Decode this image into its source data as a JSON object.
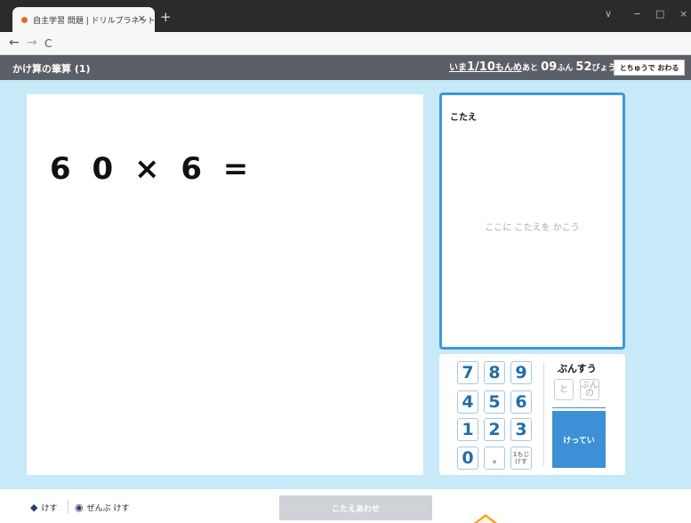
{
  "browser": {
    "tab_title": "自主学習 問題 | ドリルプラネット | ",
    "tab_close": "×",
    "new_tab": "+",
    "nav_back": "←",
    "nav_forward": "→",
    "nav_reload": "C",
    "win_dropdown": "∨",
    "win_minimize": "−",
    "win_maximize": "□",
    "win_close": "×"
  },
  "header": {
    "title": "かけ算の筆算 (1)",
    "progress_prefix": "いま",
    "progress_value": "1/10",
    "progress_suffix": "もんめ",
    "timer_prefix": "あと",
    "timer_minutes": "09",
    "timer_minutes_unit": "ふん",
    "timer_seconds": "52",
    "timer_seconds_unit": "びょう",
    "quit_label": "とちゅうで おわる"
  },
  "question": {
    "text": "6 0 × 6 ="
  },
  "answer": {
    "label": "こたえ",
    "placeholder": "ここに こたえを かこう"
  },
  "keypad": {
    "keys": [
      "7",
      "8",
      "9",
      "4",
      "5",
      "6",
      "1",
      "2",
      "3",
      "0",
      "."
    ],
    "clear_digit_line1": "1もじ",
    "clear_digit_line2": "けす",
    "fraction_label": "ぶんすう",
    "fraction_and": "と",
    "fraction_bunno_line1": "ぶん",
    "fraction_bunno_line2": "の",
    "confirm_label": "けってい"
  },
  "footer": {
    "erase_label": "けす",
    "erase_all_label": "ぜんぶ けす",
    "submit_label": "こたえあわせ"
  },
  "colors": {
    "background": "#c7e9f8",
    "accent": "#3d8fd6",
    "header": "#5b5f66"
  }
}
